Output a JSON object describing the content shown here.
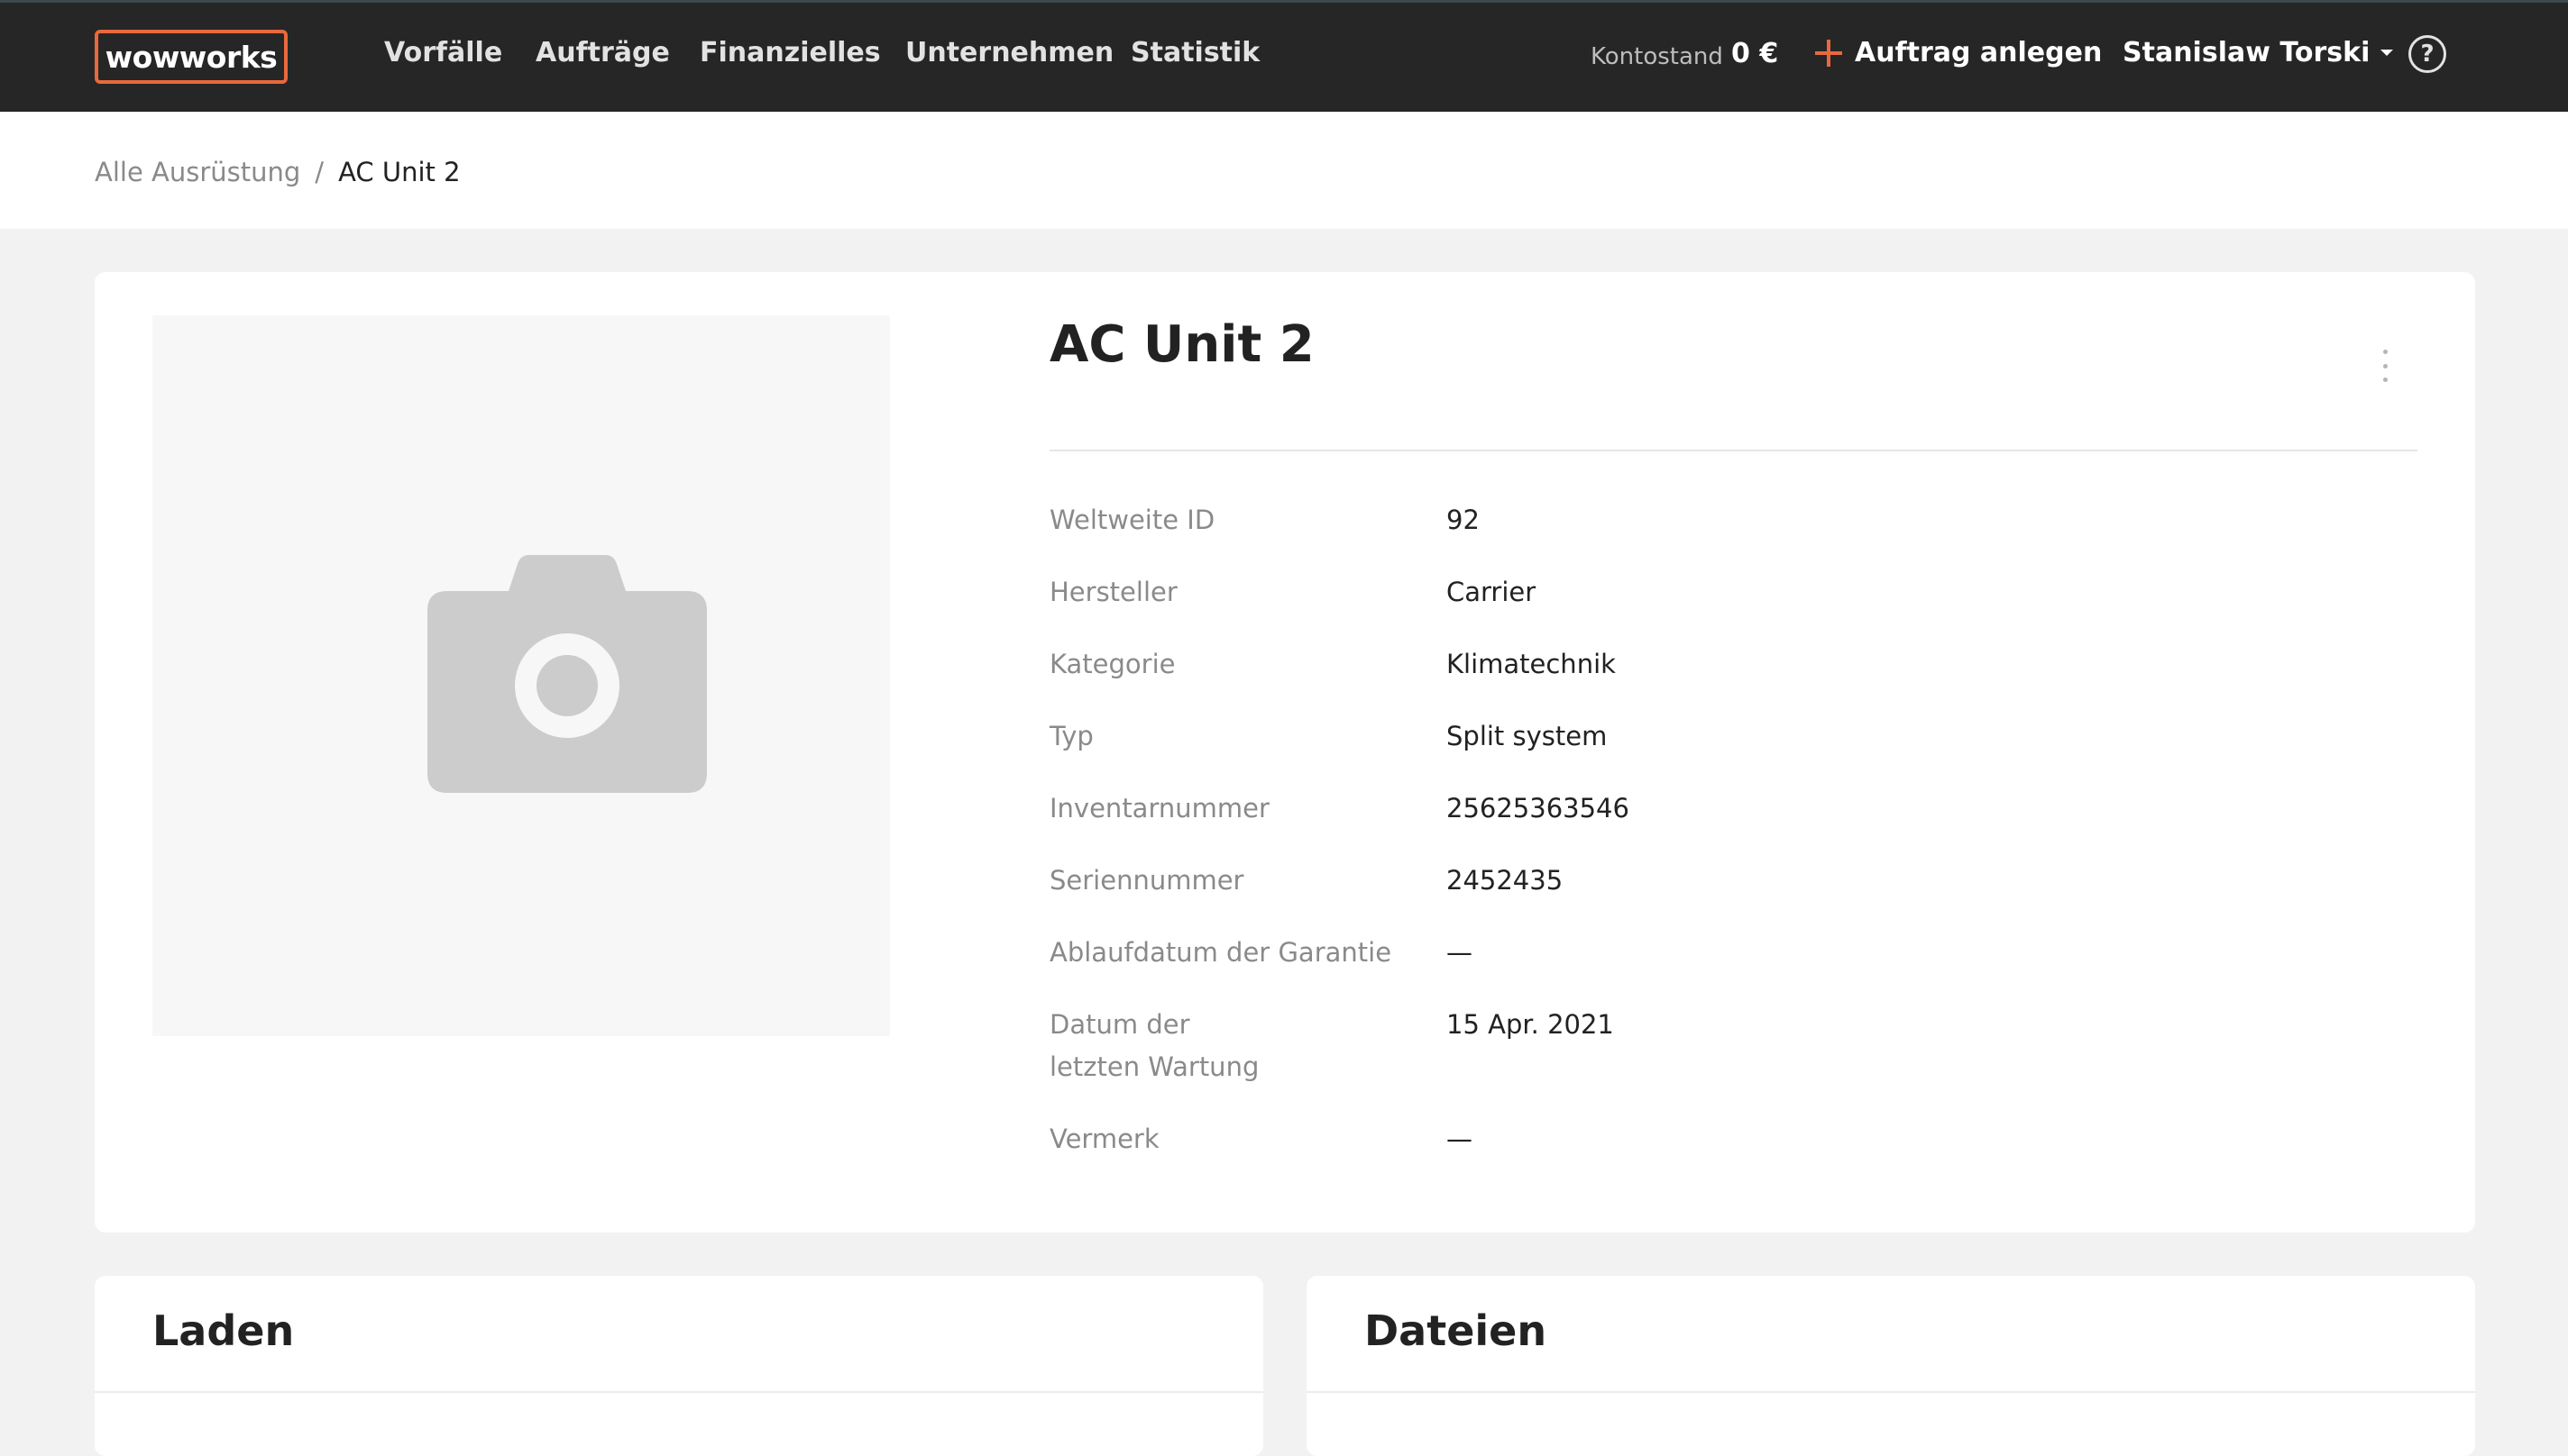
{
  "navbar": {
    "logo": "wowworks",
    "links": [
      "Vorfälle",
      "Aufträge",
      "Finanzielles",
      "Unternehmen",
      "Statistik"
    ],
    "balance_label": "Kontostand",
    "balance_value": "0 €",
    "create_order": "Auftrag anlegen",
    "user_name": "Stanislaw Torski",
    "help_symbol": "?"
  },
  "breadcrumb": {
    "parent": "Alle Ausrüstung",
    "separator": "/",
    "current": "AC Unit 2"
  },
  "equipment": {
    "title": "AC Unit 2",
    "properties": [
      {
        "label": "Weltweite ID",
        "value": "92"
      },
      {
        "label": "Hersteller",
        "value": "Carrier"
      },
      {
        "label": "Kategorie",
        "value": "Klimatechnik"
      },
      {
        "label": "Typ",
        "value": "Split system"
      },
      {
        "label": "Inventarnummer",
        "value": "25625363546"
      },
      {
        "label": "Seriennummer",
        "value": "2452435"
      },
      {
        "label": "Ablaufdatum der Garantie",
        "value": "—"
      },
      {
        "label": "Datum der letzten Wartung",
        "value": "15 Apr. 2021"
      },
      {
        "label": "Vermerk",
        "value": "—"
      }
    ]
  },
  "sections": {
    "left_title": "Laden",
    "right_title": "Dateien"
  },
  "colors": {
    "accent": "#e8693d",
    "navbar_bg": "#262626",
    "page_bg": "#f2f2f2"
  },
  "icons": [
    "plus-icon",
    "caret-down-icon",
    "help-icon",
    "camera-icon",
    "kebab-menu-icon"
  ]
}
